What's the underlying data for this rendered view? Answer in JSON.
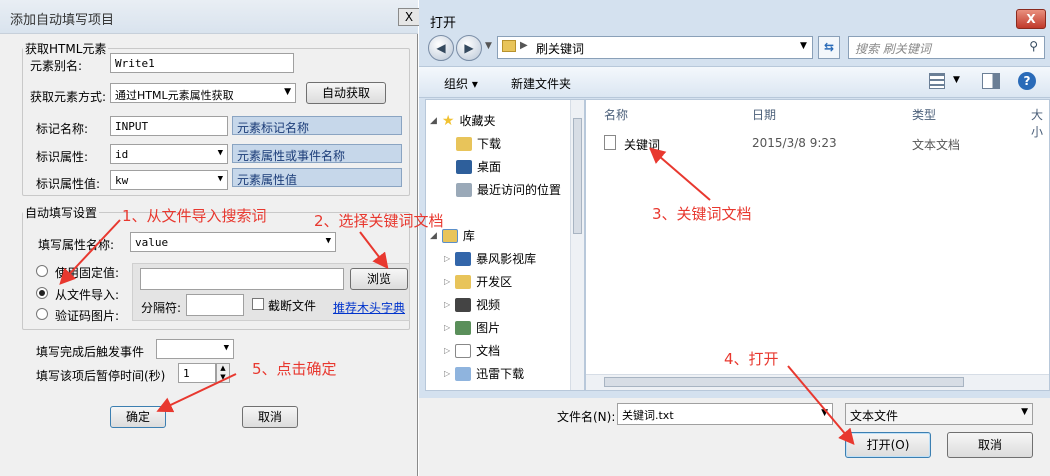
{
  "left_dialog": {
    "title": "添加自动填写项目",
    "close": "X",
    "html_group": {
      "legend": "获取HTML元素",
      "alias_label": "元素别名:",
      "alias_value": "Write1",
      "method_label": "获取元素方式:",
      "method_value": "通过HTML元素属性获取",
      "auto_button": "自动获取",
      "tag_label": "标记名称:",
      "tag_value": "INPUT",
      "tag_hint": "元素标记名称",
      "attr_label": "标识属性:",
      "attr_value": "id",
      "attr_hint": "元素属性或事件名称",
      "attrval_label": "标识属性值:",
      "attrval_value": "kw",
      "attrval_hint": "元素属性值"
    },
    "fill_group": {
      "legend": "自动填写设置",
      "prop_label": "填写属性名称:",
      "prop_value": "value",
      "radio_fixed": "使用固定值:",
      "radio_file": "从文件导入:",
      "radio_captcha": "验证码图片:",
      "browse_button": "浏览",
      "separator_label": "分隔符:",
      "truncate_label": "截断文件",
      "dict_link": "推荐木头字典"
    },
    "trigger_label": "填写完成后触发事件",
    "pause_label": "填写该项后暂停时间(秒)",
    "pause_value": "1",
    "ok_button": "确定",
    "cancel_button": "取消"
  },
  "open_dialog": {
    "title": "打开",
    "close": "X",
    "breadcrumb": "刷关键词",
    "search_placeholder": "搜索 刷关键词",
    "toolbar_organize": "组织 ▾",
    "toolbar_new_folder": "新建文件夹",
    "nav": {
      "favorites": "收藏夹",
      "downloads": "下载",
      "desktop": "桌面",
      "recent": "最近访问的位置",
      "libraries": "库",
      "lib_items": [
        "暴风影视库",
        "开发区",
        "视频",
        "图片",
        "文档",
        "迅雷下载"
      ]
    },
    "columns": {
      "name": "名称",
      "date": "日期",
      "type": "类型",
      "size": "大小"
    },
    "files": [
      {
        "name": "关键词",
        "date": "2015/3/8 9:23",
        "type": "文本文档"
      }
    ],
    "filename_label": "文件名(N):",
    "filename_value": "关键词.txt",
    "filetype_value": "文本文件",
    "open_button": "打开(O)",
    "cancel_button": "取消"
  },
  "annotations": {
    "step1": "1、从文件导入搜索词",
    "step2": "2、选择关键词文档",
    "step3": "3、关键词文档",
    "step4": "4、打开",
    "step5": "5、点击确定",
    "color": "#e8382f"
  }
}
